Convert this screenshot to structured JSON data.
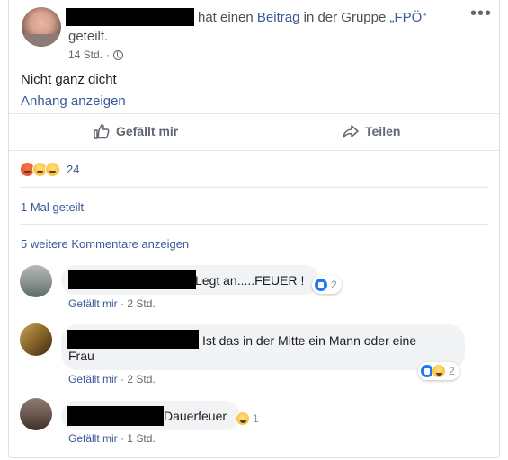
{
  "post": {
    "header_prefix": "hat einen",
    "header_link": "Beitrag",
    "header_mid": "in der Gruppe",
    "header_group": "„FPÖ“",
    "header_line2": "geteilt.",
    "time": "14 Std.",
    "dot": "·",
    "menu": "•••",
    "text": "Nicht ganz dicht",
    "attachment_link": "Anhang anzeigen"
  },
  "actions": {
    "like": "Gefällt mir",
    "share": "Teilen"
  },
  "reactions": {
    "count": "24",
    "icons": [
      "angry-icon",
      "haha-icon",
      "sad-icon"
    ]
  },
  "shares": "1 Mal geteilt",
  "more_comments": "5 weitere Kommentare anzeigen",
  "comments": [
    {
      "text": "Legt an.....FEUER !",
      "reaction_count": "2",
      "reactions": [
        "like-icon"
      ],
      "like": "Gefällt mir",
      "time": "2 Std."
    },
    {
      "text_line1": "Ist das in der Mitte ein Mann oder eine",
      "text_line2": "Frau",
      "reaction_count": "2",
      "reactions": [
        "like-icon",
        "haha-icon"
      ],
      "like": "Gefällt mir",
      "time": "2 Std."
    },
    {
      "text": "Dauerfeuer",
      "reaction_count": "1",
      "reactions": [
        "haha-icon"
      ],
      "like": "Gefällt mir",
      "time": "1 Std."
    }
  ],
  "colors": {
    "link": "#385898",
    "muted": "#616770",
    "bubble": "#f2f3f5",
    "divider": "#e5e6eb"
  }
}
